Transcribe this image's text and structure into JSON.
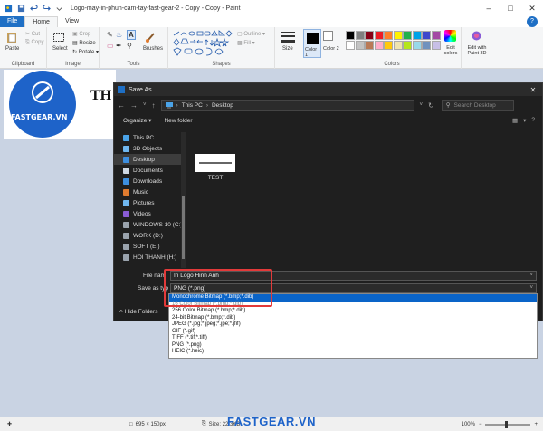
{
  "window": {
    "title": "Logo-may-in-phun-cam-tay-fast-gear-2 - Copy - Copy - Paint"
  },
  "ribbon": {
    "tabs": [
      "File",
      "Home",
      "View"
    ],
    "clipboard": {
      "paste": "Paste",
      "cut": "Cut",
      "copy": "Copy",
      "label": "Clipboard"
    },
    "image": {
      "select": "Select",
      "crop": "Crop",
      "resize": "Resize",
      "rotate": "Rotate ▾",
      "label": "Image"
    },
    "tools": {
      "label": "Tools",
      "brushes": "Brushes"
    },
    "shapes": {
      "outline": "Outline ▾",
      "fill": "Fill ▾",
      "label": "Shapes"
    },
    "size": "Size",
    "color1": "Color 1",
    "color2": "Color 2",
    "edit_colors": "Edit colors",
    "edit_3d": "Edit with Paint 3D",
    "colors_label": "Colors",
    "palette": [
      "#000000",
      "#7f7f7f",
      "#880015",
      "#ed1c24",
      "#ff7f27",
      "#fff200",
      "#22b14c",
      "#00a2e8",
      "#3f48cc",
      "#a349a4",
      "#ffffff",
      "#c3c3c3",
      "#b97a57",
      "#ffaec9",
      "#ffc90e",
      "#efe4b0",
      "#b5e61d",
      "#99d9ea",
      "#7092be",
      "#c8bfe7"
    ]
  },
  "canvas": {
    "logo_text": "FASTGEAR.VN",
    "title_fragment": "TH"
  },
  "dialog": {
    "title": "Save As",
    "address": [
      "This PC",
      "Desktop"
    ],
    "search_placeholder": "Search Desktop",
    "organize": "Organize ▾",
    "new_folder": "New folder",
    "nav": [
      {
        "label": "This PC",
        "icon": "pc-icon"
      },
      {
        "label": "3D Objects",
        "icon": "cube-icon"
      },
      {
        "label": "Desktop",
        "icon": "desktop-icon"
      },
      {
        "label": "Documents",
        "icon": "document-icon"
      },
      {
        "label": "Downloads",
        "icon": "download-icon"
      },
      {
        "label": "Music",
        "icon": "music-icon"
      },
      {
        "label": "Pictures",
        "icon": "picture-icon"
      },
      {
        "label": "Videos",
        "icon": "video-icon"
      },
      {
        "label": "WINDOWS 10 (C:)",
        "icon": "drive-icon"
      },
      {
        "label": "WORK (D:)",
        "icon": "drive-icon"
      },
      {
        "label": "SOFT (E:)",
        "icon": "drive-icon"
      },
      {
        "label": "HOI THANH (H:)",
        "icon": "drive-icon"
      }
    ],
    "file": {
      "name": "TEST"
    },
    "filename_label": "File nam",
    "filename_value": "In Logo Hinh Anh",
    "saveas_label": "Save as typ",
    "saveas_value": "PNG (*.png)",
    "hide_folders": "Hide Folders"
  },
  "dropdown": {
    "options": [
      "Monochrome Bitmap (*.bmp;*.dib)",
      "16 Color Bitmap (*.bmp;*.dib)",
      "256 Color Bitmap (*.bmp;*.dib)",
      "24-bit Bitmap (*.bmp;*.dib)",
      "JPEG (*.jpg;*.jpeg;*.jpe;*.jfif)",
      "GIF (*.gif)",
      "TIFF (*.tif;*.tiff)",
      "PNG (*.png)",
      "HEIC (*.heic)"
    ],
    "selected_index": 0
  },
  "status": {
    "dimensions": "695 × 150px",
    "size": "Size: 22,3KB",
    "zoom": "100%"
  },
  "watermark": "FASTGEAR.VN",
  "colors": {
    "accent": "#1e6fc5",
    "highlight": "#e23a3a",
    "dialog_bg": "#1f1f1f"
  }
}
